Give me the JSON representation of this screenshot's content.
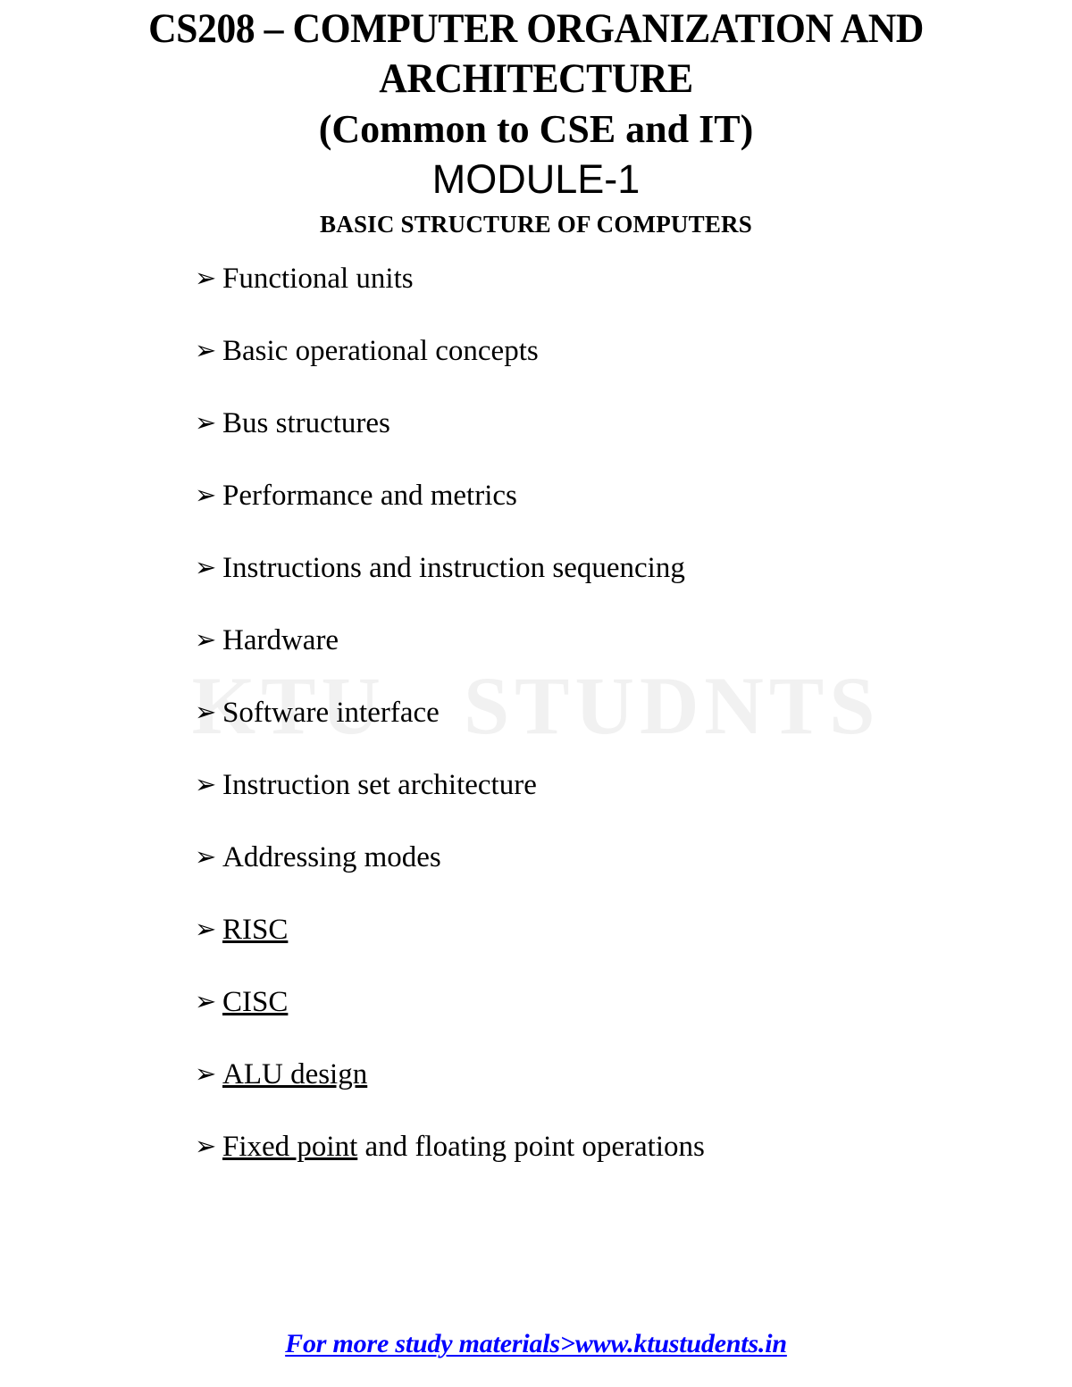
{
  "document": {
    "header": {
      "course_title_line1": "CS208 – COMPUTER ORGANIZATION AND",
      "course_title_line2": "ARCHITECTURE",
      "course_title": "CS208 – COMPUTER ORGANIZATION AND\nARCHITECTURE",
      "common_to": "(Common to CSE and IT)",
      "module": "MODULE-1",
      "module_subtitle": "BASIC STRUCTURE OF COMPUTERS"
    },
    "bullet_glyph": "➢",
    "topics": [
      {
        "label": "Functional units",
        "underlined": false
      },
      {
        "label": "Basic operational concepts",
        "underlined": false
      },
      {
        "label": "Bus structures",
        "underlined": false
      },
      {
        "label": "Performance and metrics",
        "underlined": false
      },
      {
        "label": "Instructions and instruction sequencing",
        "underlined": false
      },
      {
        "label": "Hardware",
        "underlined": false
      },
      {
        "label": "Software interface",
        "underlined": false
      },
      {
        "label": "Instruction set architecture",
        "underlined": false
      },
      {
        "label": "Addressing modes",
        "underlined": false
      },
      {
        "label": "RISC",
        "underlined": true
      },
      {
        "label": "CISC",
        "underlined": true
      },
      {
        "label": "ALU design",
        "underlined": true
      },
      {
        "label": "Fixed point and floating point operations",
        "underlined": false,
        "underlined_prefix": "Fixed point",
        "plain_suffix": " and floating point operations"
      }
    ],
    "watermark": {
      "text": "KTU   STUDNTS",
      "color": "#f1f1f1"
    },
    "footer": {
      "link_text": "For more study materials>www.ktustudents.in",
      "color": "#0000ff"
    }
  }
}
